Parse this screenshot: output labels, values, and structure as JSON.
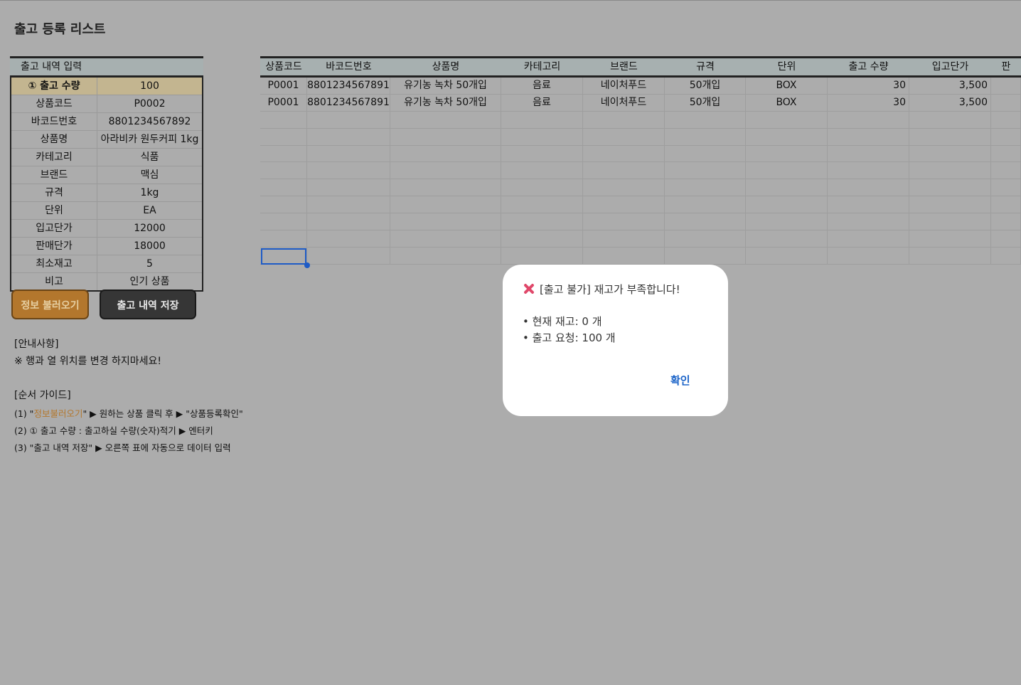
{
  "page": {
    "title": "출고 등록 리스트"
  },
  "form": {
    "header": "출고 내역 입력",
    "rows": [
      {
        "label": "① 출고 수량",
        "value": "100"
      },
      {
        "label": "상품코드",
        "value": "P0002"
      },
      {
        "label": "바코드번호",
        "value": "8801234567892"
      },
      {
        "label": "상품명",
        "value": "아라비카 원두커피 1kg"
      },
      {
        "label": "카테고리",
        "value": "식품"
      },
      {
        "label": "브랜드",
        "value": "맥심"
      },
      {
        "label": "규격",
        "value": "1kg"
      },
      {
        "label": "단위",
        "value": "EA"
      },
      {
        "label": "입고단가",
        "value": "12000"
      },
      {
        "label": "판매단가",
        "value": "18000"
      },
      {
        "label": "최소재고",
        "value": "5"
      },
      {
        "label": "비고",
        "value": "인기 상품"
      }
    ]
  },
  "buttons": {
    "load": "정보 불러오기",
    "save": "출고 내역 저장"
  },
  "notice": {
    "title": "[안내사항]",
    "text": "※ 행과 열 위치를 변경 하지마세요!"
  },
  "guide": {
    "title": "[순서 가이드]",
    "line1_pre": "(1) \"",
    "line1_hl": "정보불러오기",
    "line1_post": "\" ▶ 원하는 상품 클릭 후 ▶ \"상품등록확인\"",
    "line2": "(2) ① 출고 수량 : 출고하실 수량(숫자)적기 ▶ 엔터키",
    "line3": "(3) \"출고 내역 저장\" ▶ 오른쪽 표에 자동으로 데이터 입력"
  },
  "grid": {
    "headers": [
      "상품코드",
      "바코드번호",
      "상품명",
      "카테고리",
      "브랜드",
      "규격",
      "단위",
      "출고 수량",
      "입고단가",
      "판"
    ],
    "rows": [
      [
        "P0001",
        "8801234567891",
        "유기농 녹차 50개입",
        "음료",
        "네이처푸드",
        "50개입",
        "BOX",
        "30",
        "3,500",
        ""
      ],
      [
        "P0001",
        "8801234567891",
        "유기농 녹차 50개입",
        "음료",
        "네이처푸드",
        "50개입",
        "BOX",
        "30",
        "3,500",
        ""
      ],
      [
        "",
        "",
        "",
        "",
        "",
        "",
        "",
        "",
        "",
        ""
      ],
      [
        "",
        "",
        "",
        "",
        "",
        "",
        "",
        "",
        "",
        ""
      ],
      [
        "",
        "",
        "",
        "",
        "",
        "",
        "",
        "",
        "",
        ""
      ],
      [
        "",
        "",
        "",
        "",
        "",
        "",
        "",
        "",
        "",
        ""
      ],
      [
        "",
        "",
        "",
        "",
        "",
        "",
        "",
        "",
        "",
        ""
      ],
      [
        "",
        "",
        "",
        "",
        "",
        "",
        "",
        "",
        "",
        ""
      ],
      [
        "",
        "",
        "",
        "",
        "",
        "",
        "",
        "",
        "",
        ""
      ],
      [
        "",
        "",
        "",
        "",
        "",
        "",
        "",
        "",
        "",
        ""
      ],
      [
        "",
        "",
        "",
        "",
        "",
        "",
        "",
        "",
        "",
        ""
      ]
    ]
  },
  "dialog": {
    "icon": "close-x-icon",
    "title": "[출고 불가] 재고가 부족합니다!",
    "line1": "• 현재 재고: 0 개",
    "line2": "• 출고 요청: 100 개",
    "ok": "확인"
  },
  "colors": {
    "background": "#acacac",
    "header": "#a7b0b0",
    "highlight_row": "#c3b590",
    "load_button": "#b3772d",
    "save_button": "#363636",
    "selection": "#1e5bc6",
    "dialog_ok": "#1a63c8",
    "error_icon": "#e0486a"
  }
}
